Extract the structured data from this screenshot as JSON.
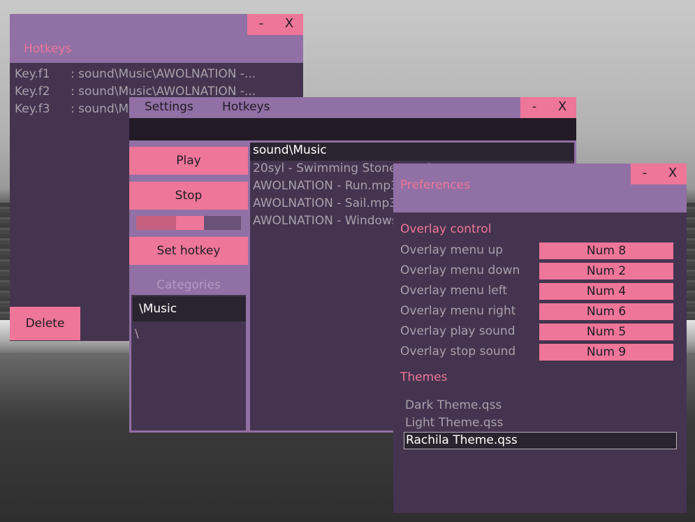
{
  "hotkeys_window": {
    "title": "Hotkeys",
    "minimize": "-",
    "close": "X",
    "rows": [
      {
        "key": "Key.f1",
        "value": ": sound\\Music\\AWOLNATION -..."
      },
      {
        "key": "Key.f2",
        "value": ": sound\\Music\\AWOLNATION -..."
      },
      {
        "key": "Key.f3",
        "value": ": sound\\Music\\AWOLNATION -..."
      }
    ],
    "delete_label": "Delete"
  },
  "main_window": {
    "menu": {
      "settings": "Settings",
      "hotkeys": "Hotkeys"
    },
    "minimize": "-",
    "close": "X",
    "play_label": "Play",
    "stop_label": "Stop",
    "volume_percent": 52,
    "set_hotkey_label": "Set hotkey",
    "categories_label": "Categories",
    "categories": [
      "\\Music",
      "\\"
    ],
    "song_list_header": "sound\\Music",
    "songs": [
      "20syl - Swimming Stones.mp3",
      "AWOLNATION - Run.mp3",
      "AWOLNATION - Sail.mp3",
      "AWOLNATION - Windows.mp3"
    ]
  },
  "preferences_window": {
    "title": "Preferences",
    "minimize": "-",
    "close": "X",
    "overlay_heading": "Overlay control",
    "overlay": [
      {
        "label": "Overlay menu up",
        "value": "Num 8"
      },
      {
        "label": "Overlay menu down",
        "value": "Num 2"
      },
      {
        "label": "Overlay menu left",
        "value": "Num 4"
      },
      {
        "label": "Overlay menu right",
        "value": "Num 6"
      },
      {
        "label": "Overlay play sound",
        "value": "Num 5"
      },
      {
        "label": "Overlay stop sound",
        "value": "Num 9"
      }
    ],
    "themes_heading": "Themes",
    "themes": [
      "Dark Theme.qss",
      "Light Theme.qss",
      "Rachila Theme.qss"
    ]
  },
  "colors": {
    "accent": "#ee7698",
    "titlebar": "#9170a5",
    "panel": "#45344f",
    "selection": "#2a2430"
  }
}
